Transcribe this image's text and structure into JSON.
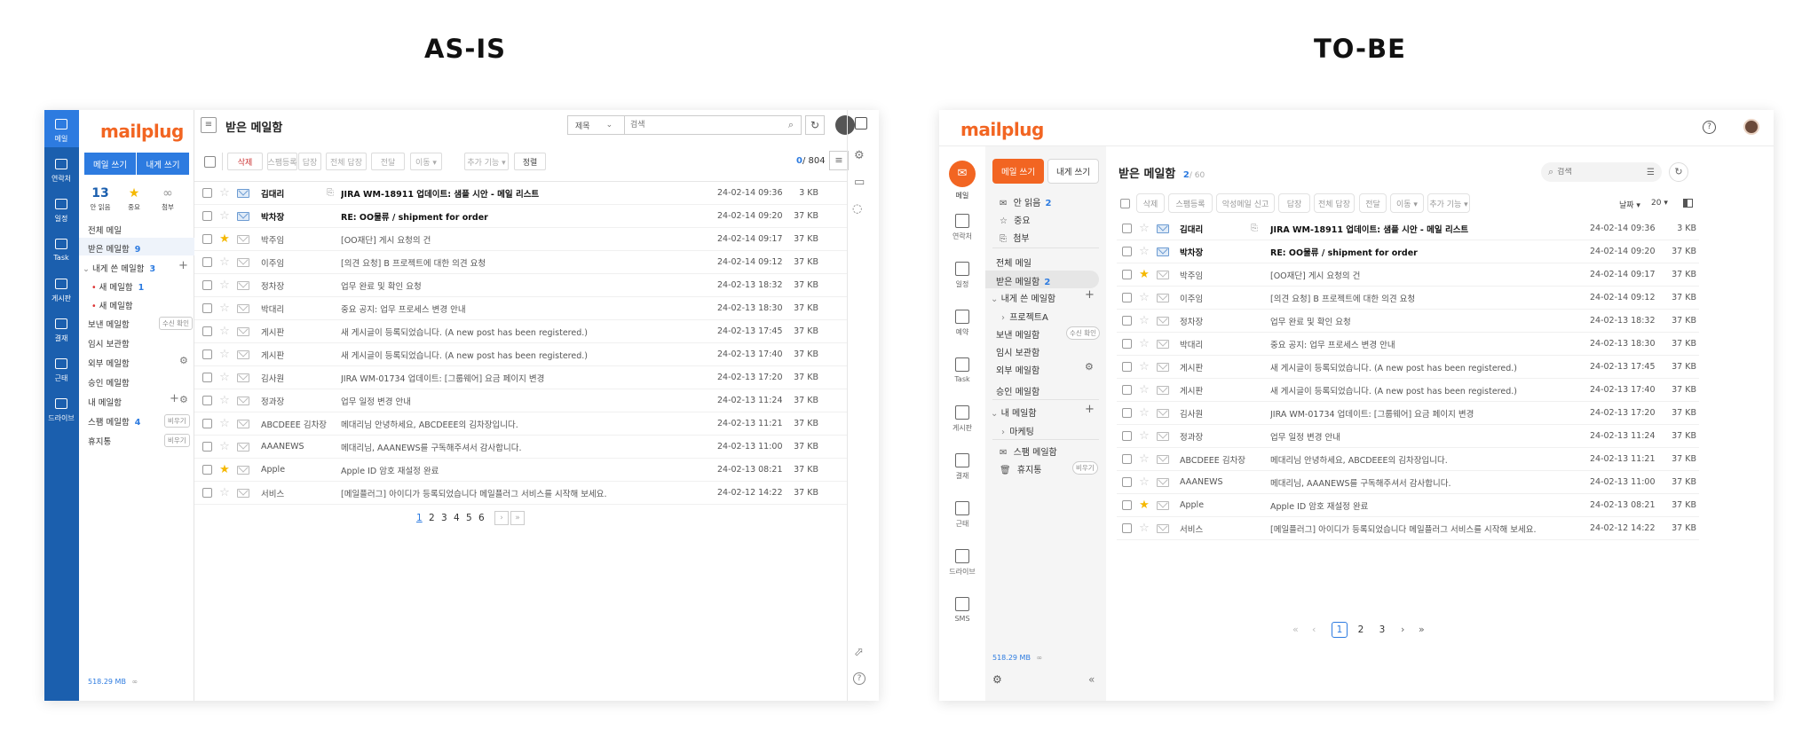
{
  "headings": {
    "left": "AS-IS",
    "right": "TO-BE"
  },
  "brand": {
    "logo": "mailplug",
    "color": "#f26522",
    "blue": "#1b5fae",
    "blue_btn": "#2d7be0"
  },
  "emails": [
    {
      "sender": "김대리",
      "subject": "JIRA WM-18911 업데이트: 샘플 시안 - 메일 리스트",
      "date": "24-02-14 09:36",
      "size": "3 KB",
      "unread": true,
      "starred": false,
      "attachment": true
    },
    {
      "sender": "박차장",
      "subject": "RE: OO물류 / shipment for order",
      "date": "24-02-14 09:20",
      "size": "37 KB",
      "unread": true,
      "starred": false,
      "attachment": false
    },
    {
      "sender": "박주임",
      "subject": "[OO재단] 게시 요청의 건",
      "date": "24-02-14 09:17",
      "size": "37 KB",
      "unread": false,
      "starred": true,
      "attachment": false
    },
    {
      "sender": "이주임",
      "subject": "[의견 요청] B 프로젝트에 대한 의견 요청",
      "date": "24-02-14 09:12",
      "size": "37 KB",
      "unread": false,
      "starred": false,
      "attachment": false
    },
    {
      "sender": "정차장",
      "subject": "업무 완료 및 확인 요청",
      "date": "24-02-13 18:32",
      "size": "37 KB",
      "unread": false,
      "starred": false,
      "attachment": false
    },
    {
      "sender": "박대리",
      "subject": "중요 공지: 업무 프로세스 변경 안내",
      "date": "24-02-13 18:30",
      "size": "37 KB",
      "unread": false,
      "starred": false,
      "attachment": false
    },
    {
      "sender": "게시판",
      "subject": "새 게시글이 등록되었습니다. (A new post has been registered.)",
      "date": "24-02-13 17:45",
      "size": "37 KB",
      "unread": false,
      "starred": false,
      "attachment": false
    },
    {
      "sender": "게시판",
      "subject": "새 게시글이 등록되었습니다. (A new post has been registered.)",
      "date": "24-02-13 17:40",
      "size": "37 KB",
      "unread": false,
      "starred": false,
      "attachment": false
    },
    {
      "sender": "김사원",
      "subject": "JIRA WM-01734 업데이트: [그룹웨어] 요금 페이지 변경",
      "date": "24-02-13 17:20",
      "size": "37 KB",
      "unread": false,
      "starred": false,
      "attachment": false
    },
    {
      "sender": "정과장",
      "subject": "업무 일정 변경 안내",
      "date": "24-02-13 11:24",
      "size": "37 KB",
      "unread": false,
      "starred": false,
      "attachment": false
    },
    {
      "sender": "ABCDEEE 김차장",
      "subject": "메대리님 안녕하세요, ABCDEEE의 김차장입니다.",
      "date": "24-02-13 11:21",
      "size": "37 KB",
      "unread": false,
      "starred": false,
      "attachment": false
    },
    {
      "sender": "AAANEWS",
      "subject": "메대리님, AAANEWS를 구독해주셔서 감사합니다.",
      "date": "24-02-13 11:00",
      "size": "37 KB",
      "unread": false,
      "starred": false,
      "attachment": false
    },
    {
      "sender": "Apple",
      "subject": "Apple ID 암호 재설정 완료",
      "date": "24-02-13 08:21",
      "size": "37 KB",
      "unread": false,
      "starred": true,
      "attachment": false
    },
    {
      "sender": "서비스",
      "subject": "[메일플러그] 아이디가 등록되었습니다 메일플러그 서비스를 시작해 보세요.",
      "date": "24-02-12 14:22",
      "size": "37 KB",
      "unread": false,
      "starred": false,
      "attachment": false
    }
  ],
  "asis": {
    "nav": [
      {
        "label": "메일",
        "icon": "mail-icon"
      },
      {
        "label": "연락처",
        "icon": "contacts-icon"
      },
      {
        "label": "일정",
        "icon": "calendar-icon"
      },
      {
        "label": "Task",
        "icon": "task-icon"
      },
      {
        "label": "게시판",
        "icon": "board-icon"
      },
      {
        "label": "결재",
        "icon": "approval-icon"
      },
      {
        "label": "근태",
        "icon": "attendance-icon"
      },
      {
        "label": "드라이브",
        "icon": "drive-icon"
      }
    ],
    "compose_label": "메일 쓰기",
    "self_label": "내게 쓰기",
    "quick": [
      {
        "value": "13",
        "label": "안 읽음"
      },
      {
        "value": "★",
        "label": "중요"
      },
      {
        "value": "∞",
        "label": "첨부"
      }
    ],
    "folders": {
      "all": "전체 메일",
      "inbox": "받은 메일함",
      "inbox_count": "9",
      "self": "내게 쓴 메일함",
      "self_count": "3",
      "new1": "새 메일함",
      "new1_count": "1",
      "new2": "새 메일함",
      "sent": "보낸 메일함",
      "sent_tag": "수신 확인",
      "temp": "임시 보관함",
      "external": "외부 메일함",
      "approval": "승인 메일함",
      "mine": "내 메일함",
      "spam": "스팸 메일함",
      "spam_count": "4",
      "spam_tag": "비우기",
      "trash": "휴지통",
      "trash_tag": "비우기"
    },
    "storage": "518.29 MB",
    "storage_suffix": "∞",
    "title": "받은 메일함",
    "search_select": "제목",
    "search_placeholder": "검색",
    "toolbar": [
      "삭제",
      "스팸등록",
      "답장",
      "전체 답장",
      "전달",
      "이동 ▾",
      "추가 기능 ▾"
    ],
    "sort_label": "정렬",
    "count_read": "0",
    "count_total": "/ 804",
    "pages": [
      "1",
      "2",
      "3",
      "4",
      "5",
      "6"
    ]
  },
  "tobe": {
    "nav": [
      {
        "label": "메일",
        "icon": "mail-icon"
      },
      {
        "label": "연락처",
        "icon": "contacts-icon"
      },
      {
        "label": "일정",
        "icon": "calendar-icon"
      },
      {
        "label": "예약",
        "icon": "reservation-icon"
      },
      {
        "label": "Task",
        "icon": "task-icon"
      },
      {
        "label": "게시판",
        "icon": "board-icon"
      },
      {
        "label": "결재",
        "icon": "approval-icon"
      },
      {
        "label": "근태",
        "icon": "attendance-icon"
      },
      {
        "label": "드라이브",
        "icon": "drive-icon"
      },
      {
        "label": "SMS",
        "icon": "sms-icon"
      }
    ],
    "compose_label": "메일 쓰기",
    "self_label": "내게 쓰기",
    "quick": {
      "unread": "안 읽음",
      "unread_count": "2",
      "important": "중요",
      "attach": "첨부"
    },
    "folders": {
      "all": "전체 메일",
      "inbox": "받은 메일함",
      "inbox_count": "2",
      "self": "내게 쓴 메일함",
      "project": "프로젝트A",
      "sent": "보낸 메일함",
      "sent_tag": "수신 확인",
      "temp": "임시 보관함",
      "external": "외부 메일함",
      "approval": "승인 메일함",
      "mine": "내 메일함",
      "marketing": "마케팅",
      "spam": "스팸 메일함",
      "trash": "휴지통",
      "trash_tag": "비우기"
    },
    "storage": "518.29 MB",
    "storage_suffix": "∞",
    "title": "받은 메일함",
    "title_count": "2",
    "title_total": "/ 60",
    "search_placeholder": "검색",
    "toolbar": [
      "삭제",
      "스팸등록",
      "악성메일 신고",
      "답장",
      "전체 답장",
      "전달",
      "이동 ▾",
      "추가 기능 ▾"
    ],
    "sort_label": "날짜 ▾",
    "per_page": "20 ▾",
    "pages": [
      "1",
      "2",
      "3"
    ]
  }
}
